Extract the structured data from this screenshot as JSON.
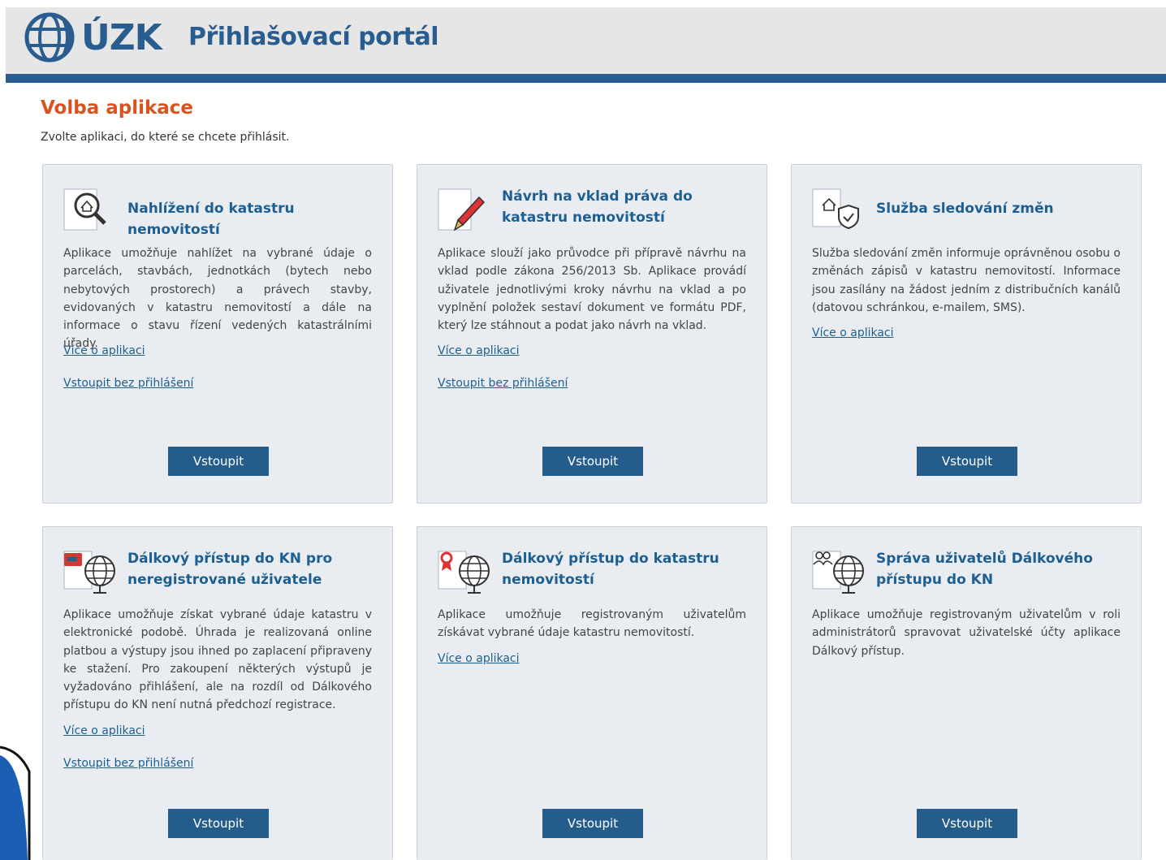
{
  "header": {
    "logo_text": "ÚZK",
    "portal_title": "Přihlašovací portál"
  },
  "page": {
    "heading": "Volba aplikace",
    "subtitle": "Zvolte aplikaci, do které se chcete přihlásit."
  },
  "cards": [
    {
      "title": "Nahlížení do katastru nemovitostí",
      "description": "Aplikace umožňuje nahlížet na vybrané údaje o parcelách, stavbách, jednotkách (bytech nebo nebytových prostorech) a právech stavby, evidovaných v katastru nemovitostí a dále na informace o stavu řízení vedených katastrálními úřady.",
      "more_link": "Více o aplikaci",
      "guest_link": "Vstoupit bez přihlášení",
      "button": "Vstoupit",
      "icon": "magnifier-house-icon"
    },
    {
      "title": "Návrh na vklad práva do katastru nemovitostí",
      "description": "Aplikace slouží jako průvodce při přípravě návrhu na vklad podle zákona 256/2013 Sb. Aplikace provádí uživatele jednotlivými kroky návrhu na vklad a po vyplnění položek sestaví dokument ve formátu PDF, který lze stáhnout a podat jako návrh na vklad.",
      "more_link": "Více o aplikaci",
      "guest_link": "Vstoupit bez přihlášení",
      "button": "Vstoupit",
      "icon": "document-pen-icon"
    },
    {
      "title": "Služba sledování změn",
      "description": "Služba sledování změn informuje oprávněnou osobu o změnách zápisů v katastru nemovitostí. Informace jsou zasílány na žádost jedním z distribučních kanálů (datovou schránkou, e-mailem, SMS).",
      "more_link": "Více o aplikaci",
      "button": "Vstoupit",
      "icon": "house-shield-icon"
    },
    {
      "title": "Dálkový přístup do KN pro neregistrované uživatele",
      "description": "Aplikace umožňuje získat vybrané údaje katastru v elektronické podobě. Úhrada je realizovaná online platbou a výstupy jsou ihned po zaplacení připraveny ke stažení. Pro zakoupení některých výstupů je vyžadováno přihlášení, ale na rozdíl od Dálkového přístupu do KN není nutná předchozí registrace.",
      "more_link": "Více o aplikaci",
      "guest_link": "Vstoupit bez přihlášení",
      "button": "Vstoupit",
      "icon": "card-globe-icon"
    },
    {
      "title": "Dálkový přístup do katastru nemovitostí",
      "description": "Aplikace umožňuje registrovaným uživatelům získávat vybrané údaje katastru nemovitostí.",
      "more_link": "Více o aplikaci",
      "button": "Vstoupit",
      "icon": "badge-globe-icon"
    },
    {
      "title": "Správa uživatelů Dálkového přístupu do KN",
      "description": "Aplikace umožňuje registrovaným uživatelům v roli administrátorů spravovat uživatelské účty aplikace Dálkový přístup.",
      "button": "Vstoupit",
      "icon": "users-globe-icon"
    }
  ],
  "colors": {
    "brand_blue": "#2a5d8f",
    "heading_orange": "#d9531e",
    "card_bg": "#e9edf2",
    "button_bg": "#245d8c"
  }
}
